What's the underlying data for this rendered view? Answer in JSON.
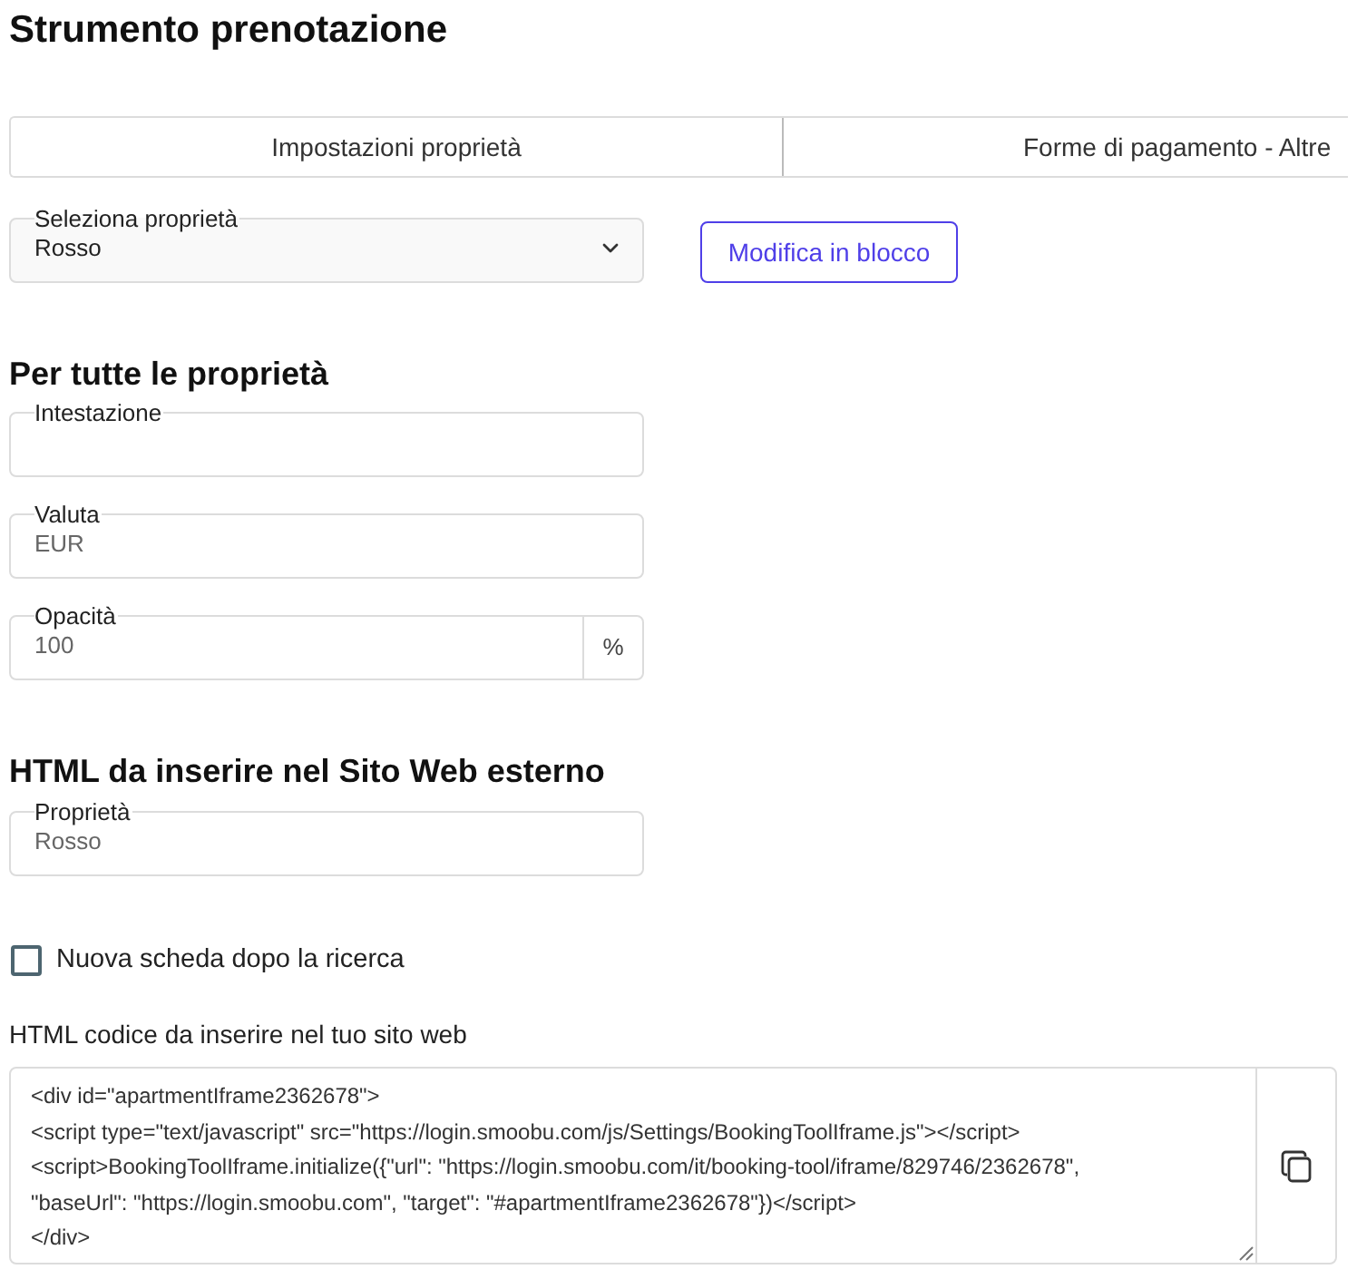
{
  "title": "Strumento prenotazione",
  "tabs": [
    {
      "label": "Impostazioni proprietà",
      "selected": false
    },
    {
      "label": "Forme di pagamento - Altre",
      "selected": false
    }
  ],
  "property_select": {
    "label": "Seleziona proprietà",
    "value": "Rosso"
  },
  "bulk_edit_button": "Modifica in blocco",
  "all_properties": {
    "heading": "Per tutte le proprietà",
    "fields": [
      {
        "label": "Intestazione"
      },
      {
        "label": "Valuta",
        "value": "EUR"
      },
      {
        "label": "Opacità",
        "value": "100",
        "unit": "%"
      }
    ]
  },
  "external_html": {
    "heading": "HTML da inserire nel Sito Web esterno",
    "property_field": {
      "label": "Proprietà",
      "value": "Rosso"
    },
    "new_tab_checkbox": {
      "label": "Nuova scheda dopo la ricerca",
      "checked": false
    },
    "code_label": "HTML codice da inserire nel tuo sito web",
    "code_lines": [
      "<div id=\"apartmentIframe2362678\">",
      "<script type=\"text/javascript\" src=\"https://login.smoobu.com/js/Settings/BookingToolIframe.js\"></script>",
      "<script>BookingToolIframe.initialize({\"url\": \"https://login.smoobu.com/it/booking-tool/iframe/829746/2362678\",",
      "\"baseUrl\": \"https://login.smoobu.com\", \"target\": \"#apartmentIframe2362678\"})</script>",
      "</div>"
    ]
  }
}
